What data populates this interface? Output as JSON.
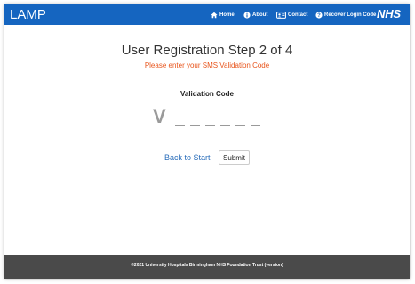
{
  "navbar": {
    "brand": "LAMP",
    "items": [
      {
        "label": "Home",
        "icon": "home-icon"
      },
      {
        "label": "About",
        "icon": "info-icon"
      },
      {
        "label": "Contact",
        "icon": "contact-icon"
      },
      {
        "label": "Recover Login Code",
        "icon": "help-icon"
      }
    ],
    "logo": "NHS"
  },
  "main": {
    "title": "User Registration Step 2 of 4",
    "subtitle": "Please enter your SMS Validation Code",
    "field_label": "Validation Code",
    "code_prefix": "V",
    "back_link": "Back to Start",
    "submit_label": "Submit"
  },
  "footer": {
    "text": "©2021 University Hospitals Birmingham NHS Foundation Trust (version)"
  },
  "colors": {
    "navbar": "#1565c0",
    "accent_text": "#e8541b",
    "link": "#2a6ebb",
    "footer": "#4a4a4a"
  }
}
